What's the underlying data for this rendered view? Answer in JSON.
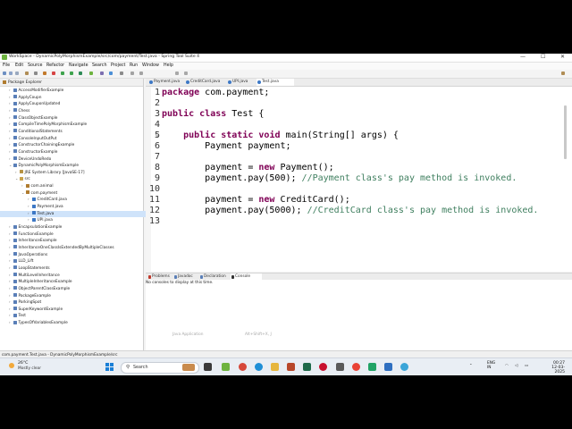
{
  "window": {
    "title": "WorkSpace - DynamicPolyMorphismExample/src/com/payment/Test.java - Spring Tool Suite 4",
    "controls": [
      "—",
      "☐",
      "✕"
    ]
  },
  "menu": [
    "File",
    "Edit",
    "Source",
    "Refactor",
    "Navigate",
    "Search",
    "Project",
    "Run",
    "Window",
    "Help"
  ],
  "explorer": {
    "title": "Package Explorer",
    "items": [
      {
        "label": "AccessModifierExample",
        "depth": 0,
        "kind": "proj",
        "tw": "›"
      },
      {
        "label": "ApplyCoupn",
        "depth": 0,
        "kind": "proj",
        "tw": "›"
      },
      {
        "label": "ApplyCouponUpdated",
        "depth": 0,
        "kind": "proj",
        "tw": "›"
      },
      {
        "label": "Chess",
        "depth": 0,
        "kind": "proj",
        "tw": "›"
      },
      {
        "label": "ClassObjectExample",
        "depth": 0,
        "kind": "proj",
        "tw": "›"
      },
      {
        "label": "CompileTimePolyMorphismExample",
        "depth": 0,
        "kind": "proj",
        "tw": "›"
      },
      {
        "label": "ConditionalStatements",
        "depth": 0,
        "kind": "proj",
        "tw": "›"
      },
      {
        "label": "ConsoleInputOutPut",
        "depth": 0,
        "kind": "proj",
        "tw": "›"
      },
      {
        "label": "ConstructorChainingExample",
        "depth": 0,
        "kind": "proj",
        "tw": "›"
      },
      {
        "label": "ConstructorExample",
        "depth": 0,
        "kind": "proj",
        "tw": "›"
      },
      {
        "label": "DeviceUndoRedo",
        "depth": 0,
        "kind": "proj",
        "tw": "›"
      },
      {
        "label": "DynamicPolyMorphismExample",
        "depth": 0,
        "kind": "proj",
        "tw": "⌄"
      },
      {
        "label": "JRE System Library [JavaSE-17]",
        "depth": 1,
        "kind": "lib",
        "tw": "›"
      },
      {
        "label": "src",
        "depth": 1,
        "kind": "src",
        "tw": "⌄"
      },
      {
        "label": "com.animal",
        "depth": 2,
        "kind": "pkg",
        "tw": "›"
      },
      {
        "label": "com.payment",
        "depth": 2,
        "kind": "pkg",
        "tw": "⌄"
      },
      {
        "label": "CreditCard.java",
        "depth": 3,
        "kind": "java",
        "tw": "›"
      },
      {
        "label": "Payment.java",
        "depth": 3,
        "kind": "java",
        "tw": "›"
      },
      {
        "label": "Test.java",
        "depth": 3,
        "kind": "java",
        "tw": "›",
        "selected": true
      },
      {
        "label": "UPI.java",
        "depth": 3,
        "kind": "java",
        "tw": "›"
      },
      {
        "label": "EncapsulationExample",
        "depth": 0,
        "kind": "proj",
        "tw": "›"
      },
      {
        "label": "FunctionsExample",
        "depth": 0,
        "kind": "proj",
        "tw": "›"
      },
      {
        "label": "InheritanceExample",
        "depth": 0,
        "kind": "proj",
        "tw": "›"
      },
      {
        "label": "InheritanceOneClassIsExtendedByMultipleClasses",
        "depth": 0,
        "kind": "proj",
        "tw": "›"
      },
      {
        "label": "JavaOperations",
        "depth": 0,
        "kind": "proj",
        "tw": "›"
      },
      {
        "label": "LLD_Lift",
        "depth": 0,
        "kind": "proj",
        "tw": "›"
      },
      {
        "label": "LoopStatements",
        "depth": 0,
        "kind": "proj",
        "tw": "›"
      },
      {
        "label": "MultiLevelInheritance",
        "depth": 0,
        "kind": "proj",
        "tw": "›"
      },
      {
        "label": "MultipleInheritanceExample",
        "depth": 0,
        "kind": "proj",
        "tw": "›"
      },
      {
        "label": "ObjectParentClassExample",
        "depth": 0,
        "kind": "proj",
        "tw": "›"
      },
      {
        "label": "PackageExample",
        "depth": 0,
        "kind": "proj",
        "tw": "›"
      },
      {
        "label": "ParkingSpot",
        "depth": 0,
        "kind": "proj",
        "tw": "›"
      },
      {
        "label": "SuperKeywordExample",
        "depth": 0,
        "kind": "proj",
        "tw": "›"
      },
      {
        "label": "Test",
        "depth": 0,
        "kind": "proj",
        "tw": "›"
      },
      {
        "label": "TypesOfVariablesExample",
        "depth": 0,
        "kind": "proj",
        "tw": "›"
      }
    ]
  },
  "editor": {
    "tabs": [
      {
        "label": "Payment.java",
        "active": false
      },
      {
        "label": "CreditCard.java",
        "active": false
      },
      {
        "label": "UPI.java",
        "active": false
      },
      {
        "label": "Test.java",
        "active": true
      }
    ],
    "lines": [
      {
        "n": "1",
        "segs": [
          {
            "t": "package",
            "c": "kw"
          },
          {
            "t": " com.payment;",
            "c": ""
          }
        ]
      },
      {
        "n": "2",
        "segs": []
      },
      {
        "n": "3",
        "segs": [
          {
            "t": "public",
            "c": "kw"
          },
          {
            "t": " ",
            "c": ""
          },
          {
            "t": "class",
            "c": "kw"
          },
          {
            "t": " Test {",
            "c": ""
          }
        ]
      },
      {
        "n": "4",
        "segs": []
      },
      {
        "n": "5",
        "fold": true,
        "segs": [
          {
            "t": "    ",
            "c": ""
          },
          {
            "t": "public",
            "c": "kw"
          },
          {
            "t": " ",
            "c": ""
          },
          {
            "t": "static",
            "c": "kw"
          },
          {
            "t": " ",
            "c": ""
          },
          {
            "t": "void",
            "c": "kw"
          },
          {
            "t": " main(String[] args) {",
            "c": ""
          }
        ]
      },
      {
        "n": "6",
        "segs": [
          {
            "t": "        Payment payment;",
            "c": ""
          }
        ]
      },
      {
        "n": "7",
        "segs": []
      },
      {
        "n": "8",
        "segs": [
          {
            "t": "        payment = ",
            "c": ""
          },
          {
            "t": "new",
            "c": "kw"
          },
          {
            "t": " Payment();",
            "c": ""
          }
        ]
      },
      {
        "n": "9",
        "segs": [
          {
            "t": "        payment.pay(500); ",
            "c": ""
          },
          {
            "t": "//Payment class's pay method is invoked.",
            "c": "cm"
          }
        ]
      },
      {
        "n": "10",
        "segs": []
      },
      {
        "n": "11",
        "segs": [
          {
            "t": "        payment = ",
            "c": ""
          },
          {
            "t": "new",
            "c": "kw"
          },
          {
            "t": " CreditCard();",
            "c": ""
          }
        ]
      },
      {
        "n": "12",
        "segs": [
          {
            "t": "        payment.pay(5000); ",
            "c": ""
          },
          {
            "t": "//CreditCard class's pay method is invoked.",
            "c": "cm"
          }
        ]
      },
      {
        "n": "13",
        "segs": []
      }
    ]
  },
  "bottom": {
    "tabs": [
      {
        "label": "Problems",
        "active": false,
        "color": "#c0392b"
      },
      {
        "label": "Javadoc",
        "active": false,
        "color": "#5a7fb8"
      },
      {
        "label": "Declaration",
        "active": false,
        "color": "#5a7fb8"
      },
      {
        "label": "Console",
        "active": true,
        "color": "#333333"
      }
    ],
    "message": "No consoles to display at this time.",
    "hint_left": "Java Application",
    "hint_right": "Alt+Shift+X, J"
  },
  "status": "com.payment.Test.java - DynamicPolyMorphismExample/src",
  "taskbar": {
    "temp": "26°C",
    "condition": "Mostly clear",
    "search_placeholder": "Search",
    "lang_top": "ENG",
    "lang_bottom": "IN",
    "time": "00:27",
    "date": "12-03-2025"
  },
  "colors": {
    "keyword": "#7f0055",
    "comment": "#3f7f5f",
    "selection": "#cfe3fa"
  }
}
